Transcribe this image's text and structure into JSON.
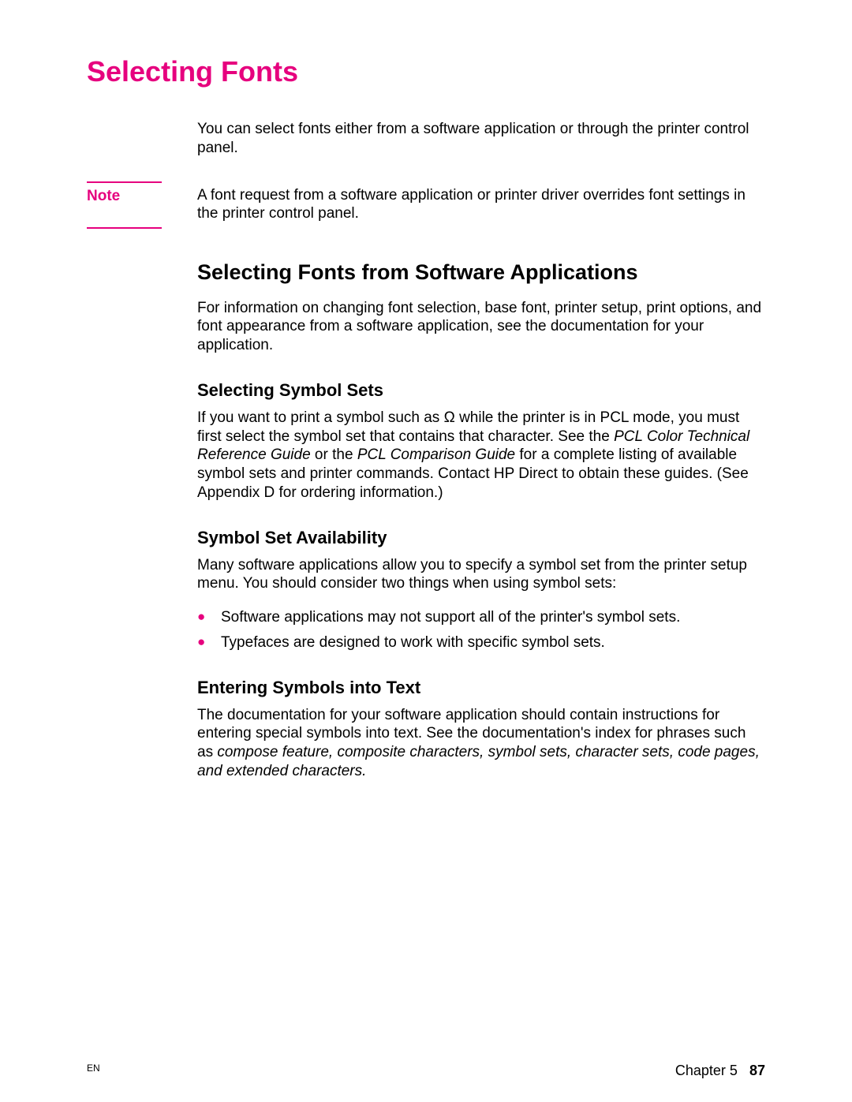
{
  "title": "Selecting Fonts",
  "intro": "You can select fonts either from a software application or through the printer control panel.",
  "note": {
    "label": "Note",
    "text": "A font request from a software application or printer driver overrides font settings in the printer control panel."
  },
  "section1": {
    "heading": "Selecting Fonts from Software Applications",
    "body": "For information on changing font selection, base font, printer setup, print options, and font appearance from a software application, see the documentation for your application."
  },
  "sub1": {
    "heading": "Selecting Symbol Sets",
    "body_pre": "If you want to print a symbol such as Ω while the printer is in PCL mode, you must first select the symbol set that contains that character. See the ",
    "italic1": "PCL Color Technical Reference Guide",
    "mid1": " or the ",
    "italic2": "PCL Comparison Guide",
    "body_post": " for a complete listing of available symbol sets and printer commands. Contact HP Direct to obtain these guides. (See Appendix D for ordering information.)"
  },
  "sub2": {
    "heading": "Symbol Set Availability",
    "body": "Many software applications allow you to specify a symbol set from the printer setup menu. You should consider two things when using symbol sets:",
    "bullets": [
      "Software applications may not support all of the printer's symbol sets.",
      "Typefaces are designed to work with specific symbol sets."
    ]
  },
  "sub3": {
    "heading": "Entering Symbols into Text",
    "body_pre": "The documentation for your software application should contain instructions for entering special symbols into text. See the documentation's index for phrases such as ",
    "italic": "compose feature, composite characters, symbol sets, character sets, code pages, and extended characters."
  },
  "footer": {
    "left": "EN",
    "chapter": "Chapter 5",
    "page": "87"
  }
}
